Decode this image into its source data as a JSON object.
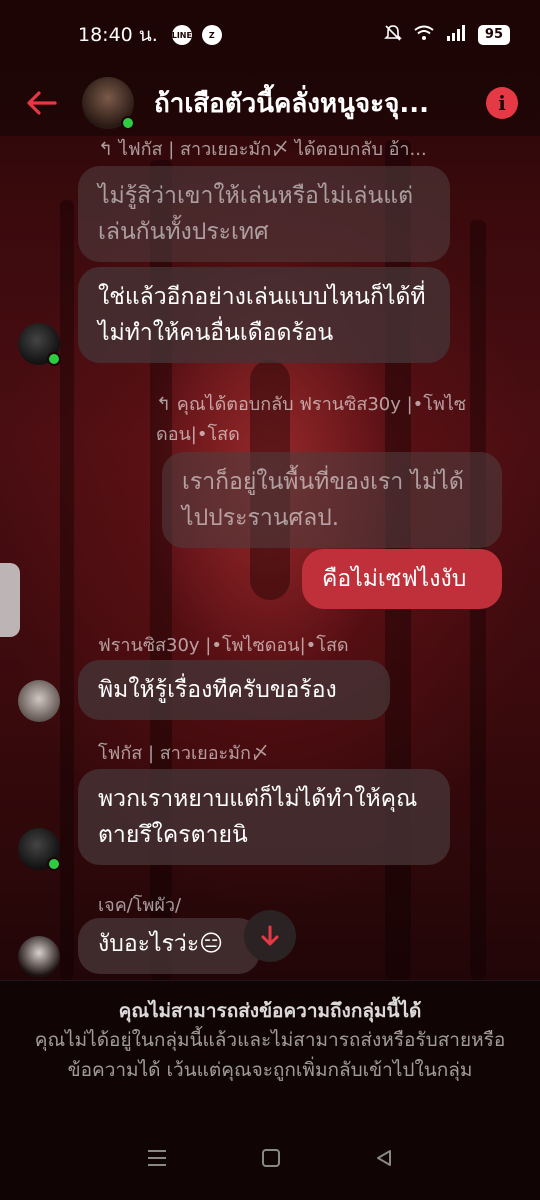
{
  "status_bar": {
    "time": "18:40 น.",
    "app_icons": [
      "line-icon",
      "z-app-icon"
    ],
    "app_labels": [
      "LINE",
      "Z"
    ],
    "battery": "95"
  },
  "header": {
    "title": "ถ้าเสือตัวนี้คลั่งหนูจะจุ...",
    "back_icon": "back-arrow-icon",
    "info_icon": "info-icon"
  },
  "messages": {
    "m1": {
      "reply_meta": "↰ ไฟกัส | สาวเยอะมัก〆 ได้ตอบกลับ อ้า...",
      "quoted_text": "ไม่รู้สิว่าเขาให้เล่นหรือไม่เล่นแต่เล่นกันทั้งประเทศ",
      "text": "ใช่แล้วอีกอย่างเล่นแบบไหนก็ได้ที่ไม่ทำให้คนอื่นเดือดร้อน"
    },
    "m2": {
      "reply_meta": "↰ คุณได้ตอบกลับ ฟรานซิส30y |•โพไซดอน|•โสด",
      "quoted_text": "เราก็อยู่ในพื้นที่ของเรา ไม่ได้ไปประรานศลป.",
      "text": "คือไม่เซฟไงงับ"
    },
    "m3": {
      "sender": "ฟรานซิส30y |•โพไซดอน|•โสด",
      "text": "พิมให้รู้เรื่องทีครับขอร้อง"
    },
    "m4": {
      "sender": "โฟกัส | สาวเยอะมัก〆",
      "text": "พวกเราหยาบแต่ก็ไม่ได้ทำให้คุณตายรึใครตายนิ"
    },
    "m5": {
      "sender": "เจค/โพผัว/",
      "text": "งับอะไรว่ะ😑"
    }
  },
  "notice": {
    "title": "คุณไม่สามารถส่งข้อความถึงกลุ่มนี้ได้",
    "body": "คุณไม่ได้อยู่ในกลุ่มนี้แล้วและไม่สามารถส่งหรือรับสายหรือข้อความได้ เว้นแต่คุณจะถูกเพิ่มกลับเข้าไปในกลุ่ม"
  },
  "colors": {
    "accent": "#e63946",
    "my_bubble": "#c0303a",
    "online": "#2ecc40"
  }
}
